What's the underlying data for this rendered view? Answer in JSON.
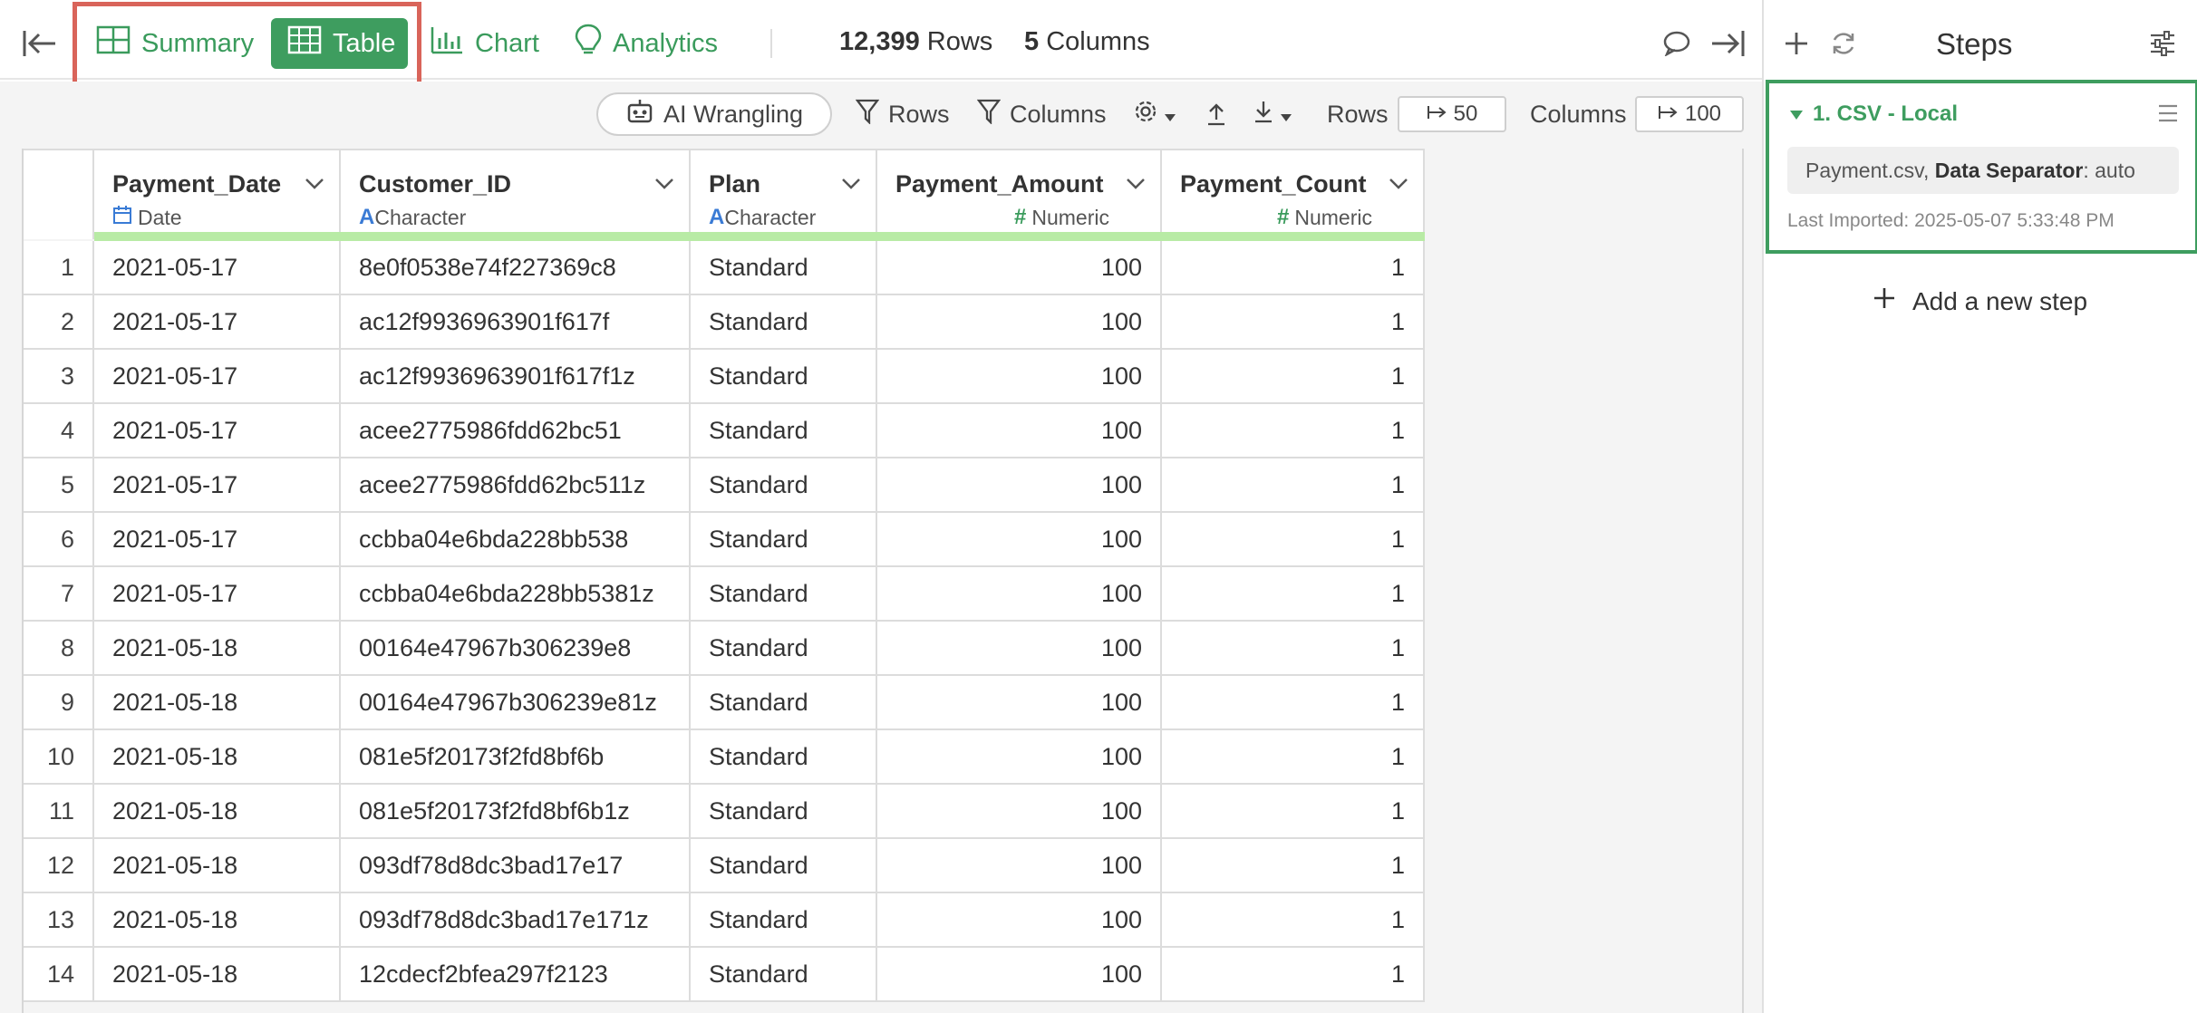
{
  "nav": {
    "tabs": [
      {
        "label": "Summary",
        "icon": "summary-grid-icon",
        "active": false
      },
      {
        "label": "Table",
        "icon": "table-icon",
        "active": true
      },
      {
        "label": "Chart",
        "icon": "bar-chart-icon",
        "active": false
      },
      {
        "label": "Analytics",
        "icon": "lightbulb-icon",
        "active": false
      }
    ],
    "rows_count": "12,399",
    "rows_label": "Rows",
    "cols_count": "5",
    "cols_label": "Columns"
  },
  "toolbar": {
    "ai_label": "AI Wrangling",
    "rows_filter_label": "Rows",
    "columns_filter_label": "Columns",
    "rows_label": "Rows",
    "rows_value": "50",
    "columns_label": "Columns",
    "columns_value": "100"
  },
  "table": {
    "columns": [
      {
        "name": "Payment_Date",
        "type": "Date",
        "type_icon": "calendar-icon"
      },
      {
        "name": "Customer_ID",
        "type": "Character",
        "type_icon": "character-icon"
      },
      {
        "name": "Plan",
        "type": "Character",
        "type_icon": "character-icon"
      },
      {
        "name": "Payment_Amount",
        "type": "Numeric",
        "type_icon": "hash-icon"
      },
      {
        "name": "Payment_Count",
        "type": "Numeric",
        "type_icon": "hash-icon"
      }
    ],
    "rows": [
      [
        "1",
        "2021-05-17",
        "8e0f0538e74f227369c8",
        "Standard",
        "100",
        "1"
      ],
      [
        "2",
        "2021-05-17",
        "ac12f9936963901f617f",
        "Standard",
        "100",
        "1"
      ],
      [
        "3",
        "2021-05-17",
        "ac12f9936963901f617f1z",
        "Standard",
        "100",
        "1"
      ],
      [
        "4",
        "2021-05-17",
        "acee2775986fdd62bc51",
        "Standard",
        "100",
        "1"
      ],
      [
        "5",
        "2021-05-17",
        "acee2775986fdd62bc511z",
        "Standard",
        "100",
        "1"
      ],
      [
        "6",
        "2021-05-17",
        "ccbba04e6bda228bb538",
        "Standard",
        "100",
        "1"
      ],
      [
        "7",
        "2021-05-17",
        "ccbba04e6bda228bb5381z",
        "Standard",
        "100",
        "1"
      ],
      [
        "8",
        "2021-05-18",
        "00164e47967b306239e8",
        "Standard",
        "100",
        "1"
      ],
      [
        "9",
        "2021-05-18",
        "00164e47967b306239e81z",
        "Standard",
        "100",
        "1"
      ],
      [
        "10",
        "2021-05-18",
        "081e5f20173f2fd8bf6b",
        "Standard",
        "100",
        "1"
      ],
      [
        "11",
        "2021-05-18",
        "081e5f20173f2fd8bf6b1z",
        "Standard",
        "100",
        "1"
      ],
      [
        "12",
        "2021-05-18",
        "093df78d8dc3bad17e17",
        "Standard",
        "100",
        "1"
      ],
      [
        "13",
        "2021-05-18",
        "093df78d8dc3bad17e171z",
        "Standard",
        "100",
        "1"
      ],
      [
        "14",
        "2021-05-18",
        "12cdecf2bfea297f2123",
        "Standard",
        "100",
        "1"
      ]
    ]
  },
  "steps": {
    "title": "Steps",
    "items": [
      {
        "title": "1. CSV - Local",
        "file": "Payment.csv,",
        "separator_label": "Data Separator",
        "separator_value": ": auto",
        "imported": "Last Imported: 2025-05-07 5:33:48 PM"
      }
    ],
    "add_label": "Add a new step"
  },
  "colors": {
    "accent": "#3e9d5f",
    "highlight": "#d9645a",
    "type_bar": "#b8eba5"
  }
}
